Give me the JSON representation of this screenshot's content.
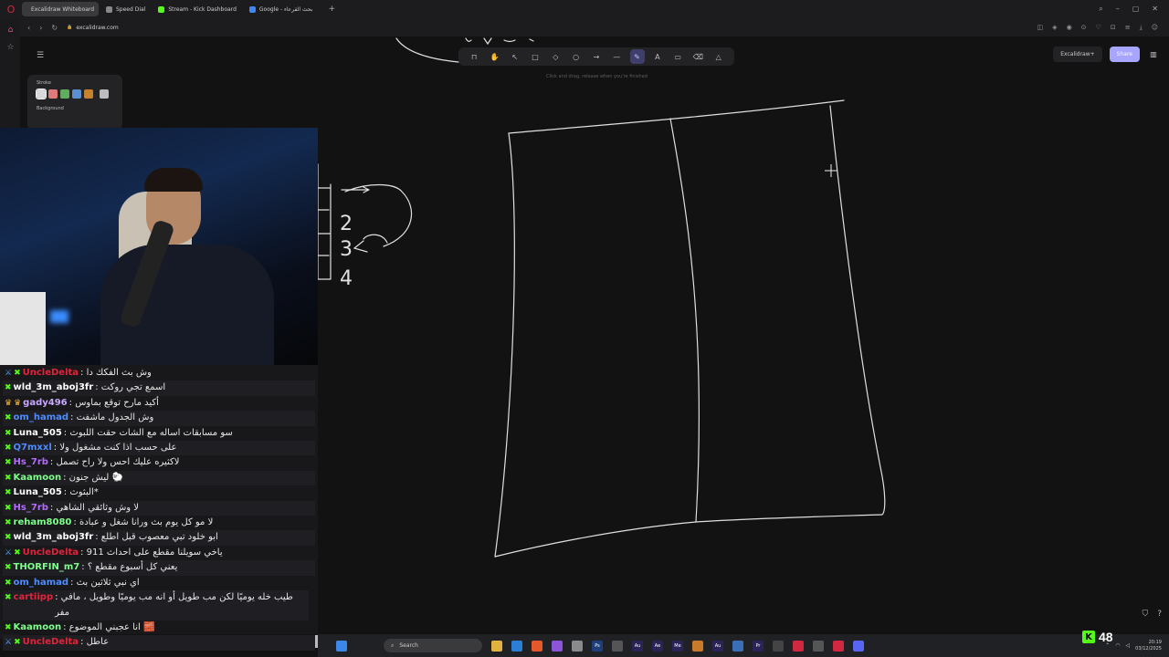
{
  "browser": {
    "tabs": [
      {
        "label": "Excalidraw Whiteboard",
        "color": "#6965db",
        "active": true
      },
      {
        "label": "Speed Dial",
        "color": "#888888",
        "active": false
      },
      {
        "label": "Stream - Kick Dashboard",
        "color": "#53fc18",
        "active": false
      },
      {
        "label": "Google - بحث القرعاء",
        "color": "#4285f4",
        "active": false
      }
    ],
    "url": "excalidraw.com"
  },
  "excalidraw": {
    "stroke_label": "Stroke",
    "background_label": "Background",
    "stroke_colors": [
      "#d9d9d9",
      "#e07a7a",
      "#5fae5f",
      "#5a8fd1",
      "#c7822e"
    ],
    "hint": "Click and drag, release when you're finished",
    "plus_label": "Excalidraw+",
    "share_label": "Share",
    "sketch_numbers": [
      "2",
      "3",
      "4"
    ]
  },
  "chat": {
    "messages": [
      {
        "user": "UncleDelta",
        "color": "#e0243b",
        "text": "وش بث الفكك دا",
        "badges": [
          "sword",
          "kick"
        ]
      },
      {
        "user": "wld_3m_aboj3fr",
        "color": "#ffffff",
        "text": "اسمع تجي روكت",
        "badges": [
          "kick"
        ]
      },
      {
        "user": "gady496",
        "color": "#c9a7ff",
        "text": "أكيد مارح توقع بماوس",
        "badges": [
          "crown",
          "crown"
        ]
      },
      {
        "user": "om_hamad",
        "color": "#4e8cff",
        "text": "وش الجدول ماشفت",
        "badges": [
          "kick"
        ]
      },
      {
        "user": "Luna_505",
        "color": "#ffffff",
        "text": "سو مسابقات اساله مع الشات حقت اللبوث",
        "badges": [
          "kick"
        ]
      },
      {
        "user": "Q7mxxl",
        "color": "#4e8cff",
        "text": "على حسب اذا كنت مشغول ولا",
        "badges": [
          "kick"
        ]
      },
      {
        "user": "Hs_7rb",
        "color": "#b36bff",
        "text": "لاكثيره عليك احس ولا راح تصمل",
        "badges": [
          "kick"
        ]
      },
      {
        "user": "Kaamoon",
        "color": "#7dff8a",
        "text": "ليش جنون 🐑",
        "badges": [
          "kick"
        ]
      },
      {
        "user": "Luna_505",
        "color": "#ffffff",
        "text": "البثوث*",
        "badges": [
          "kick"
        ]
      },
      {
        "user": "Hs_7rb",
        "color": "#b36bff",
        "text": "لا وش وثائقي الشاهي",
        "badges": [
          "kick"
        ]
      },
      {
        "user": "reham8080",
        "color": "#7dff8a",
        "text": "لا مو كل يوم بث ورانا شغل و عبادة",
        "badges": [
          "kick"
        ]
      },
      {
        "user": "wld_3m_aboj3fr",
        "color": "#ffffff",
        "text": "ابو خلود تبي معصوب قبل اطلع",
        "badges": [
          "kick"
        ]
      },
      {
        "user": "UncleDelta",
        "color": "#e0243b",
        "text": "ياخي سويلنا مقطع على احداث 911",
        "badges": [
          "sword",
          "kick"
        ]
      },
      {
        "user": "THORFIN_m7",
        "color": "#7dff8a",
        "text": "يعني كل أسبوع مقطع ؟",
        "badges": [
          "kick"
        ]
      },
      {
        "user": "om_hamad",
        "color": "#4e8cff",
        "text": "اي نبي ثلاثين بث",
        "badges": [
          "kick"
        ]
      },
      {
        "user": "cartiipp",
        "color": "#e0243b",
        "text": "طيب خله يوميًا لكن مب طويل أو انه مب يوميًا وطويل ، مافي مفر",
        "badges": [
          "kick"
        ],
        "wrap": true
      },
      {
        "user": "Kaamoon",
        "color": "#7dff8a",
        "text": "انا عجبني الموضوع 🧱",
        "badges": [
          "kick"
        ]
      },
      {
        "user": "UncleDelta",
        "color": "#e0243b",
        "text": "عاطل",
        "badges": [
          "sword",
          "kick"
        ]
      }
    ]
  },
  "taskbar": {
    "search_placeholder": "Search",
    "time": "20:19",
    "date": "03/12/2025"
  },
  "stream": {
    "viewers": "48"
  }
}
